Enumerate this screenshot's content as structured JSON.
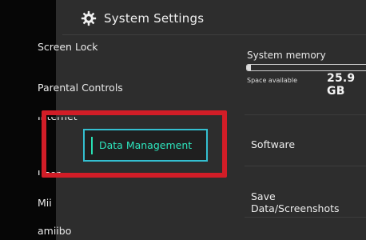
{
  "header": {
    "title": "System Settings",
    "icon": "gear-icon"
  },
  "sidebar": {
    "items": [
      {
        "label": "Screen Lock"
      },
      {
        "label": "Parental Controls"
      },
      {
        "label": "Internet"
      },
      {
        "label": "Data Management",
        "selected": true
      },
      {
        "label": "User"
      },
      {
        "label": "Mii"
      },
      {
        "label": "amiibo"
      }
    ]
  },
  "memory": {
    "label": "System memory",
    "space_label": "Space available",
    "space_value": "25.9 GB",
    "fill_fraction": 0.03
  },
  "options": [
    {
      "label": "Software"
    },
    {
      "label": "Save Data/Screenshots"
    }
  ],
  "colors": {
    "background": "#2d2d2d",
    "selection_border": "#34bfd0",
    "selection_text": "#2de6be",
    "annotation_red": "#d11d27"
  }
}
